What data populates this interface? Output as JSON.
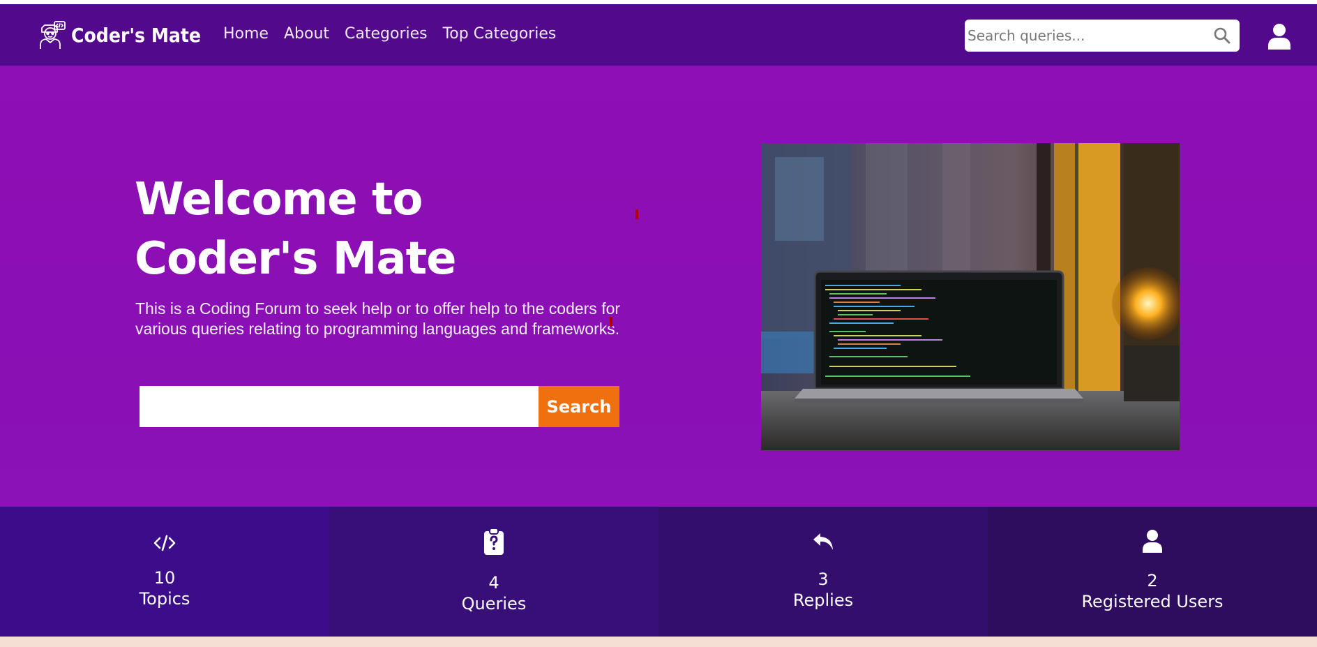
{
  "brand": {
    "name": "Coder's Mate"
  },
  "nav": {
    "links": [
      {
        "label": "Home"
      },
      {
        "label": "About"
      },
      {
        "label": "Categories"
      },
      {
        "label": "Top Categories"
      }
    ],
    "search_placeholder": "Search queries...",
    "search_icon": "search-icon",
    "user_icon": "user-icon"
  },
  "hero": {
    "title": "Welcome to Coder's Mate",
    "description": "This is a Coding Forum to seek help or to offer help to the coders for various queries relating to programming languages and frameworks.",
    "search_value": "",
    "search_button": "Search"
  },
  "stats": [
    {
      "icon": "code-icon",
      "value": "10",
      "label": "Topics"
    },
    {
      "icon": "clipboard-question-icon",
      "value": "4",
      "label": "Queries"
    },
    {
      "icon": "reply-icon",
      "value": "3",
      "label": "Replies"
    },
    {
      "icon": "user-icon",
      "value": "2",
      "label": "Registered Users"
    }
  ],
  "colors": {
    "navbar": "#53098c",
    "hero": "#8d0fb5",
    "accent": "#f07010",
    "stat_1": "#3c0d8a",
    "stat_2": "#380e78",
    "stat_3": "#340e6c",
    "stat_4": "#2f0d5e"
  }
}
